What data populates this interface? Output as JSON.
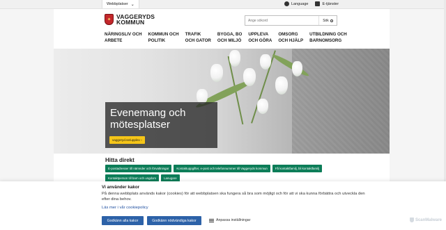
{
  "topbar": {
    "site_select": "Webbplatser",
    "language": "Language",
    "eservices": "E-tjänster"
  },
  "header": {
    "logo_line1": "VAGGERYDS",
    "logo_line2": "KOMMUN",
    "search_placeholder": "Ange sökord",
    "search_button": "Sök"
  },
  "nav": {
    "items": [
      {
        "line1": "NÄRINGSLIV OCH",
        "line2": "ARBETE"
      },
      {
        "line1": "KOMMUN OCH",
        "line2": "POLITIK"
      },
      {
        "line1": "TRAFIK",
        "line2": "OCH GATOR"
      },
      {
        "line1": "BYGGA, BO",
        "line2": "OCH MILJÖ"
      },
      {
        "line1": "UPPLEVA",
        "line2": "OCH GÖRA"
      },
      {
        "line1": "OMSORG",
        "line2": "OCH HJÄLP"
      },
      {
        "line1": "UTBILDNING OCH",
        "line2": "BARNOMSORG"
      }
    ]
  },
  "hero": {
    "title": "Evenemang och mötesplatser",
    "button": "vaggeryd.se/upplev ›"
  },
  "direct": {
    "heading": "Hitta direkt",
    "links": [
      "E-postadresser till nämnder och förvaltningar",
      "Kontaktuppgifter, e-post och telefonnummer till Vaggeryds kommun",
      "Få kontaktfamilj, bli kontaktfamilj",
      "Kontaktperson till barn och ungdom",
      "Lanugare"
    ]
  },
  "cookie": {
    "heading": "Vi använder kakor",
    "text": "På denna webbplats används kakor (cookies) för att webbplatsen ska fungera så bra som möjligt och för att vi ska kunna förbättra och utveckla den efter dina behov.",
    "policy_link": "Läs mer i vår cookiepolicy",
    "accept_all": "Godkänn alla kakor",
    "accept_necessary": "Godkänn nödvändiga kakor",
    "adjust": "Anpassa inställningar"
  },
  "watermark": "ScanMalware"
}
